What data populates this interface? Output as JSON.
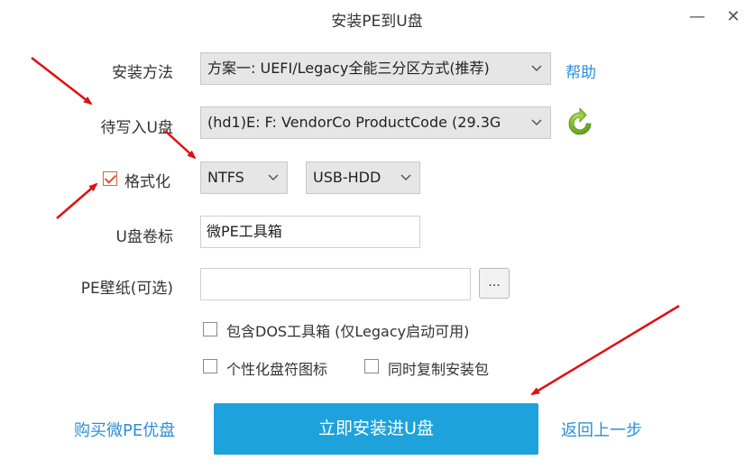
{
  "window": {
    "title": "安装PE到U盘",
    "minimize_glyph": "—",
    "close_glyph": "✕"
  },
  "install_method": {
    "label": "安装方法",
    "value": "方案一: UEFI/Legacy全能三分区方式(推荐)",
    "help_link": "帮助"
  },
  "target_drive": {
    "label": "待写入U盘",
    "value": "(hd1)E: F: VendorCo ProductCode (29.3G",
    "refresh_icon": "refresh-icon",
    "refresh_color": "#7cbf2a"
  },
  "format": {
    "checkbox_label": "格式化",
    "checked": true,
    "filesystem": "NTFS",
    "mode": "USB-HDD"
  },
  "volume_label": {
    "label": "U盘卷标",
    "value": "微PE工具箱"
  },
  "wallpaper": {
    "label": "PE壁纸(可选)",
    "value": "",
    "browse_label": "..."
  },
  "options": {
    "include_dos": {
      "label": "包含DOS工具箱 (仅Legacy启动可用)",
      "checked": false
    },
    "custom_icon": {
      "label": "个性化盘符图标",
      "checked": false
    },
    "copy_package": {
      "label": "同时复制安装包",
      "checked": false
    }
  },
  "footer": {
    "buy_link": "购买微PE优盘",
    "install_button": "立即安装进U盘",
    "back_link": "返回上一步"
  },
  "colors": {
    "accent": "#1ea2dc",
    "link": "#2b8fd6",
    "annotation_arrow": "#e01010"
  }
}
